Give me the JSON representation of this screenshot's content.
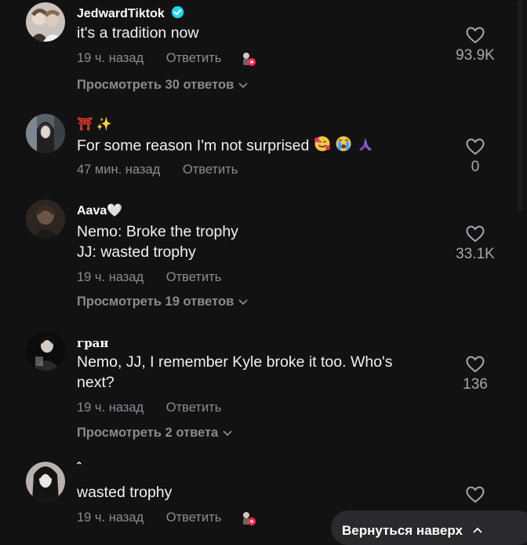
{
  "comments": [
    {
      "username": "JedwardTiktok",
      "verified": true,
      "text_lines": [
        "it's a tradition now"
      ],
      "time": "19 ч. назад",
      "reply_label": "Ответить",
      "liked_by_creator": true,
      "view_replies": "Просмотреть 30 ответов",
      "likes": "93.9K"
    },
    {
      "username": "⛩ ✨",
      "text_lines": [
        "For some reason I'm not surprised"
      ],
      "time": "47 мин. назад",
      "reply_label": "Ответить",
      "likes": "0"
    },
    {
      "username": "Aava🤍",
      "text_lines": [
        "Nemo: Broke the trophy",
        "JJ: wasted trophy"
      ],
      "time": "19 ч. назад",
      "reply_label": "Ответить",
      "view_replies": "Просмотреть 19 ответов",
      "likes": "33.1K"
    },
    {
      "username": "гран",
      "text_lines": [
        "Nemo, JJ, I remember Kyle broke it too. Who's",
        "next?"
      ],
      "time": "19 ч. назад",
      "reply_label": "Ответить",
      "view_replies": "Просмотреть 2 ответа",
      "likes": "136"
    },
    {
      "username": "ˆ",
      "text_lines": [
        "wasted trophy"
      ],
      "time": "19 ч. назад",
      "reply_label": "Ответить",
      "liked_by_creator": true
    }
  ],
  "back_to_top_label": "Вернуться наверх",
  "colors": {
    "background": "#121212",
    "muted_text": "#8a8b91",
    "verified_badge": "#20d5ec",
    "creator_heart": "#fe2c55"
  },
  "icons": {
    "like": "heart-outline-icon",
    "verified": "verified-badge-icon",
    "expand": "chevron-down-icon",
    "back_to_top": "chevron-up-icon"
  }
}
